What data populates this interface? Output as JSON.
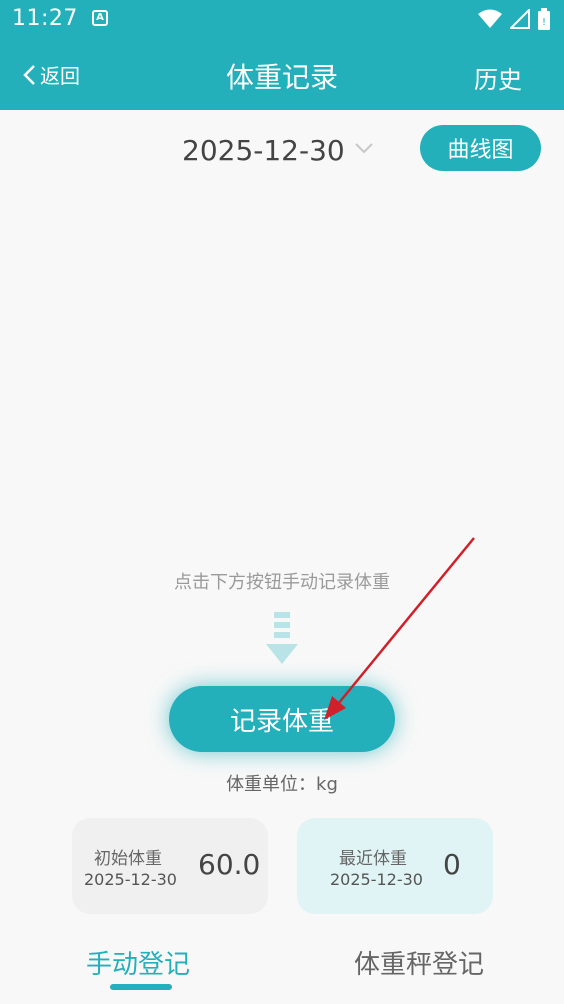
{
  "status_bar": {
    "time": "11:27",
    "notification_letter": "A"
  },
  "header": {
    "back_label": "返回",
    "title": "体重记录",
    "history_label": "历史"
  },
  "date_selector": {
    "date": "2025-12-30",
    "chart_button_label": "曲线图"
  },
  "main": {
    "hint": "点击下方按钮手动记录体重",
    "record_button_label": "记录体重",
    "unit_line": "体重单位：kg"
  },
  "cards": {
    "initial": {
      "label": "初始体重",
      "date": "2025-12-30",
      "value": "60.0"
    },
    "recent": {
      "label": "最近体重",
      "date": "2025-12-30",
      "value": "0"
    }
  },
  "tabs": {
    "manual": "手动登记",
    "scale": "体重秤登记"
  },
  "colors": {
    "accent": "#24b0bb",
    "annotation_arrow": "#d0202a"
  }
}
